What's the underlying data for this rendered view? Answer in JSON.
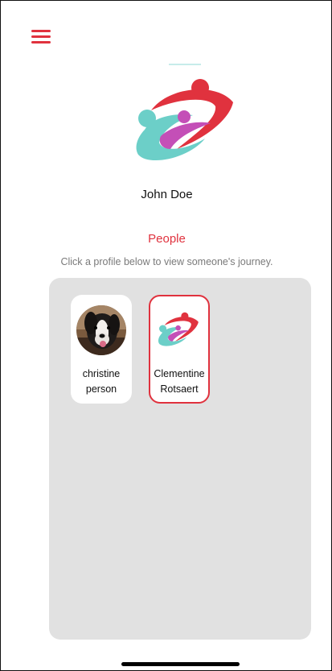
{
  "header": {
    "menu_icon": "hamburger-menu-icon"
  },
  "profile": {
    "name": "John Doe",
    "logo_icon": "family-logo-icon"
  },
  "people": {
    "title": "People",
    "instructions": "Click a profile below to view someone's journey.",
    "cards": [
      {
        "first": "christine",
        "last": "person",
        "avatar": "dog-photo-avatar",
        "selected": false
      },
      {
        "first": "Clementine",
        "last": "Rotsaert",
        "avatar": "family-logo-avatar",
        "selected": true
      }
    ]
  },
  "colors": {
    "accent": "#e0323e",
    "panel": "#e1e1e1",
    "teal": "#6ccfc8",
    "purple": "#c44fb7",
    "muted_text": "#7a7a7a"
  }
}
